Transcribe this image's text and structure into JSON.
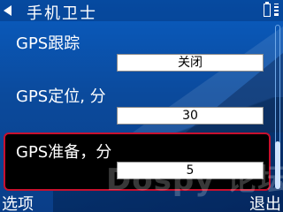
{
  "header": {
    "title": "手机卫士"
  },
  "settings": [
    {
      "label": "GPS跟踪",
      "value": "关闭"
    },
    {
      "label": "GPS定位, 分",
      "value": "30"
    },
    {
      "label": "GPS准备，分",
      "value": "5"
    }
  ],
  "watermark": "Dospy 论坛",
  "softkeys": {
    "left": "选项",
    "right": "退出"
  },
  "colors": {
    "background": "#0b4fa0",
    "selection_border": "#c8102e",
    "selection_fill": "#000000"
  },
  "icons": {
    "back": "back-arrow-icon",
    "battery": "battery-icon",
    "signal": "signal-icon"
  }
}
